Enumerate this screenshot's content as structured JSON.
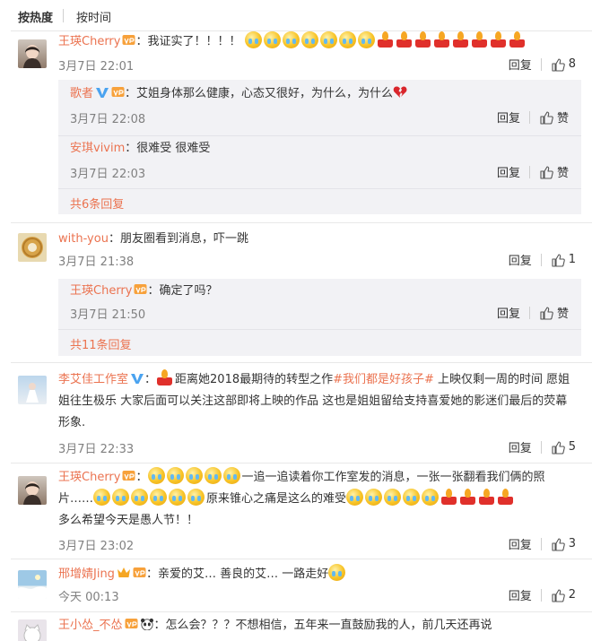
{
  "sort": {
    "hot_label": "按热度",
    "time_label": "按时间"
  },
  "comments": [
    {
      "user": "王瑛Cherry",
      "text": "：我证实了！！！！",
      "time": "3月7日 22:01",
      "reply_label": "回复",
      "likes": "8",
      "replies": [
        {
          "user": "歌者",
          "text": "：艾姐身体那么健康，心态又很好，为什么，为什么",
          "time": "3月7日 22:08",
          "reply_label": "回复",
          "like_label": "赞"
        },
        {
          "user": "安琪vivim",
          "text": "：很难受  很难受",
          "time": "3月7日 22:03",
          "reply_label": "回复",
          "like_label": "赞"
        }
      ],
      "more": "共6条回复"
    },
    {
      "user": "with-you",
      "text": "：朋友圈看到消息，吓一跳",
      "time": "3月7日 21:38",
      "reply_label": "回复",
      "likes": "1",
      "replies": [
        {
          "user": "王瑛Cherry",
          "text": "：确定了吗？",
          "time": "3月7日 21:50",
          "reply_label": "回复",
          "like_label": "赞"
        }
      ],
      "more": "共11条回复"
    },
    {
      "user": "李艾佳工作室",
      "text_a": "：",
      "text_b": "距离她2018最期待的转型之作",
      "topic": "#我们都是好孩子#",
      "text_c": " 上映仅剩一周的时间  愿姐姐往生极乐 大家后面可以关注这部即将上映的作品 这也是姐姐留给支持喜爱她的影迷们最后的荧幕形象.",
      "time": "3月7日 22:33",
      "reply_label": "回复",
      "likes": "5"
    },
    {
      "user": "王瑛Cherry",
      "text_a": "：",
      "text_b": "一追一追读着你工作室发的消息，一张一张翻看我们俩的照片……",
      "text_c": "原来锥心之痛是这么的难受",
      "text_d": "多么希望今天是愚人节！！",
      "time": "3月7日 23:02",
      "reply_label": "回复",
      "likes": "3"
    },
    {
      "user": "邢增婧Jing",
      "text": "：亲爱的艾… 善良的艾… 一路走好",
      "time": "今天 00:13",
      "reply_label": "回复",
      "likes": "2"
    },
    {
      "user": "王小怂_不怂",
      "text": "：怎么会？？？不想相信，五年来一直鼓励我的人，前几天还再说"
    }
  ],
  "icons": {
    "crying": "crying-face-icon",
    "candle": "candle-icon",
    "thumb": "thumbs-up-icon",
    "broken_heart": "broken-heart-icon",
    "vip": "vip-crown-icon",
    "verified": "verified-v-icon"
  },
  "colors": {
    "username": "#eb7350",
    "time": "#808080",
    "reply_bg": "#f2f2f5",
    "text": "#333333"
  }
}
